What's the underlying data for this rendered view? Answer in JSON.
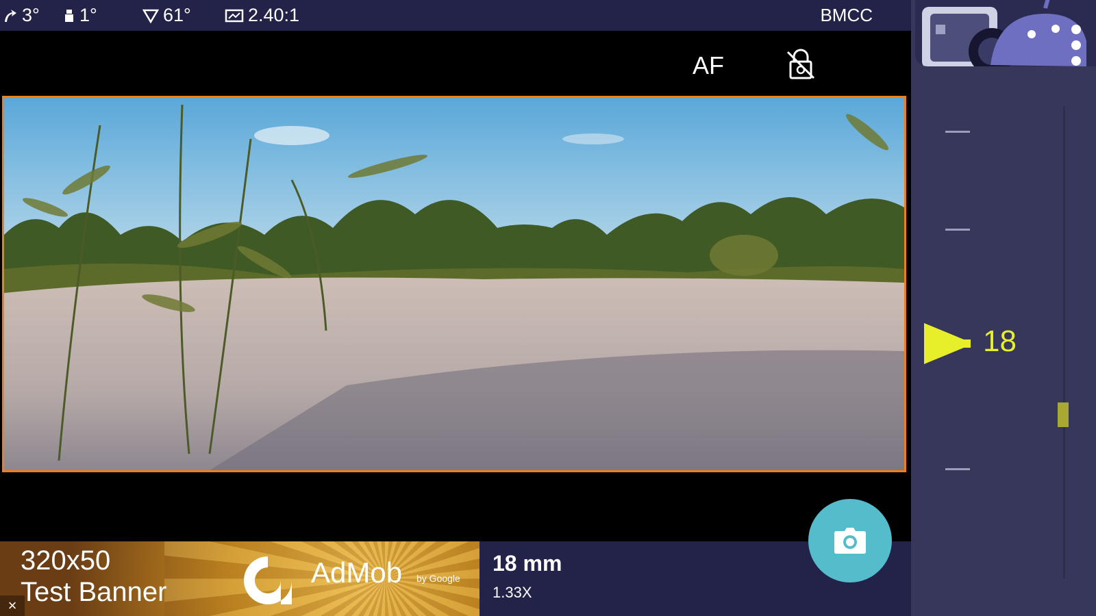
{
  "status_bar": {
    "tilt": "3°",
    "roll": "1°",
    "field_of_view": "61°",
    "aspect_ratio": "2.40:1",
    "camera_format": "BMCC"
  },
  "toolbar": {
    "af_label": "AF",
    "lock_icon": "lock-icon"
  },
  "ad": {
    "size_label": "320x50",
    "title": "Test Banner",
    "brand": "AdMob",
    "brand_by": "by Google",
    "close": "×"
  },
  "lens": {
    "focal_length": "18 mm",
    "zoom": "1.33X"
  },
  "slider": {
    "value_label": "18",
    "handle_position_fraction": 0.63
  },
  "colors": {
    "frame_accent": "#f07f1a",
    "status_bar_bg": "#232349",
    "sidebar_bg": "#36375b",
    "shutter_button": "#54bccb",
    "slider_value": "#e6ef2a"
  }
}
